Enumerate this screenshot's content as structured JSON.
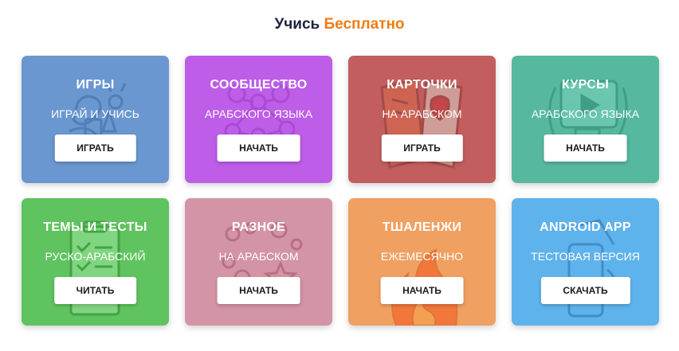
{
  "heading": {
    "text": "Учись",
    "accent": "Бесплатно",
    "text_color": "#1c2340",
    "accent_color": "#f07c12"
  },
  "cards": [
    {
      "title": "ИГРЫ",
      "subtitle": "ИГРАЙ И УЧИСЬ",
      "button": "ИГРАТЬ",
      "color": "#6a97cf",
      "icon": "toys-icon"
    },
    {
      "title": "СООБЩЕСТВО",
      "subtitle": "АРАБСКОГО ЯЗЫКА",
      "button": "НАЧАТЬ",
      "color": "#bd5de8",
      "icon": "community-network-icon"
    },
    {
      "title": "КАРТОЧКИ",
      "subtitle": "НА АРАБСКОМ",
      "button": "ИГРАТЬ",
      "color": "#c25e5e",
      "icon": "flashcards-icon"
    },
    {
      "title": "КУРСЫ",
      "subtitle": "АРАБСКОГО ЯЗЫКА",
      "button": "НАЧАТЬ",
      "color": "#56b89f",
      "icon": "video-course-icon"
    },
    {
      "title": "ТЕМЫ И ТЕСТЫ",
      "subtitle": "РУСКО-АРАБСКИЙ",
      "button": "ЧИТАТЬ",
      "color": "#5fc35f",
      "icon": "checklist-icon"
    },
    {
      "title": "РАЗНОЕ",
      "subtitle": "НА АРАБСКОМ",
      "button": "НАЧАТЬ",
      "color": "#d394a5",
      "icon": "shapes-icon"
    },
    {
      "title": "ТШАЛЕНЖИ",
      "subtitle": "ЕЖЕМЕСЯЧНО",
      "button": "НАЧАТЬ",
      "color": "#f0a061",
      "icon": "flame-icon"
    },
    {
      "title": "ANDROID APP",
      "subtitle": "ТЕСТОВАЯ ВЕРСИЯ",
      "button": "СКАЧАТЬ",
      "color": "#5fb3ec",
      "icon": "phone-icon"
    }
  ]
}
